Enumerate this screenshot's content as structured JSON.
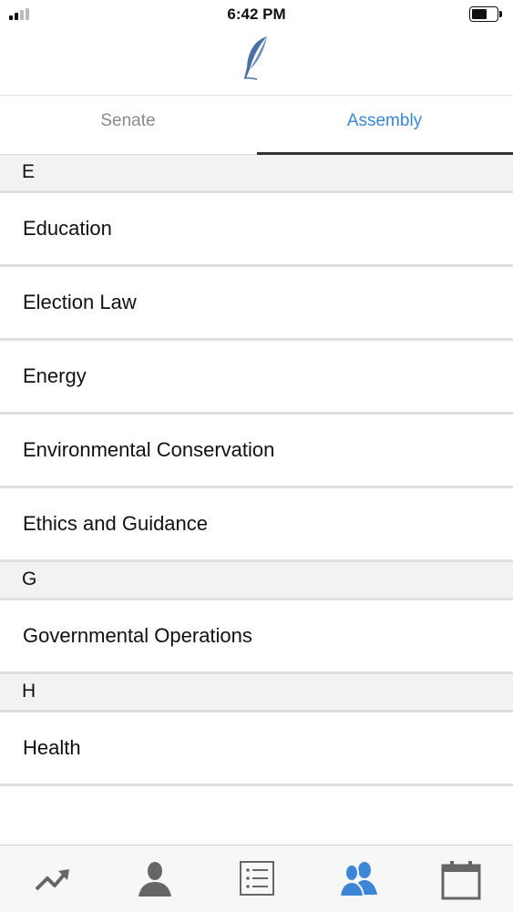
{
  "status_bar": {
    "time": "6:42 PM"
  },
  "header": {
    "logo_icon": "quill-icon",
    "logo_color": "#4a6fa5"
  },
  "tabs": [
    {
      "label": "Senate",
      "active": false
    },
    {
      "label": "Assembly",
      "active": true
    }
  ],
  "accent_color": "#3d86d6",
  "list": {
    "section_e": {
      "title": "E"
    },
    "items_e": [
      {
        "label": "Education"
      },
      {
        "label": "Election Law"
      },
      {
        "label": "Energy"
      },
      {
        "label": "Environmental Conservation"
      },
      {
        "label": "Ethics and Guidance"
      }
    ],
    "section_g": {
      "title": "G"
    },
    "items_g": [
      {
        "label": "Governmental Operations"
      }
    ],
    "section_h": {
      "title": "H"
    },
    "items_h": [
      {
        "label": "Health"
      }
    ]
  },
  "tab_bar": [
    {
      "icon": "trending-icon",
      "active": false
    },
    {
      "icon": "person-icon",
      "active": false
    },
    {
      "icon": "list-icon",
      "active": false
    },
    {
      "icon": "people-icon",
      "active": true
    },
    {
      "icon": "calendar-icon",
      "active": false
    }
  ]
}
